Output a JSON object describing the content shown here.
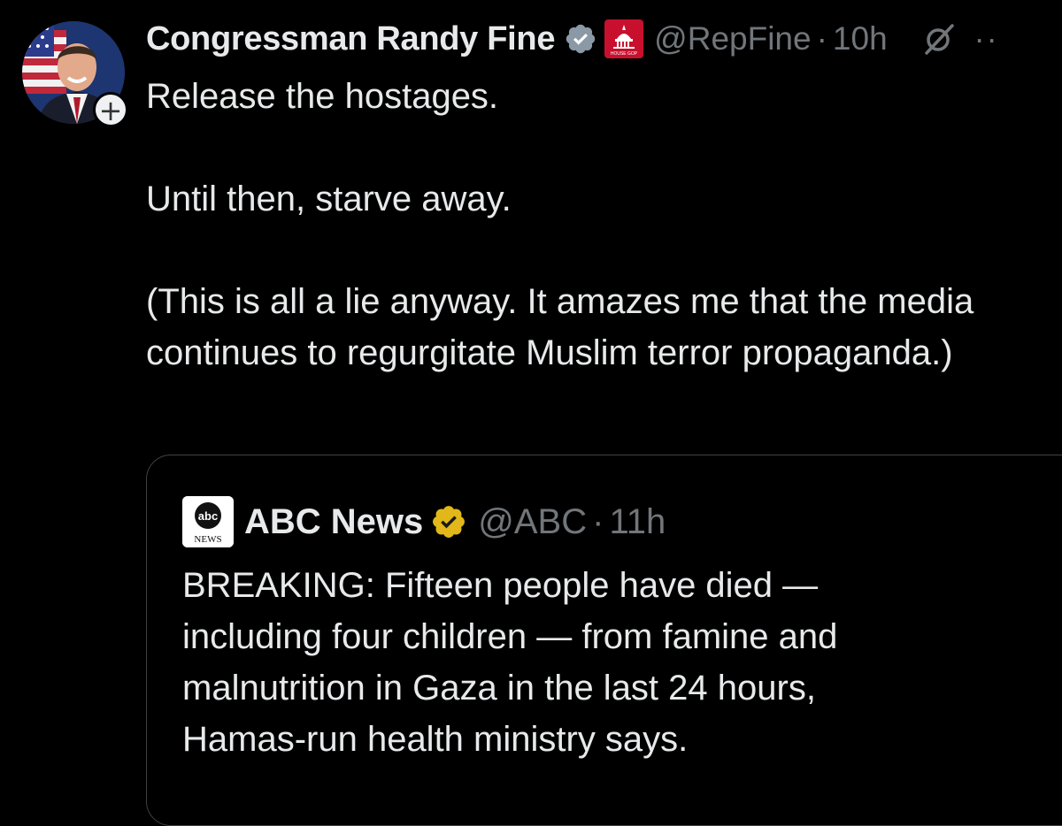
{
  "tweet": {
    "author_name": "Congressman Randy Fine",
    "handle": "@RepFine",
    "separator": "·",
    "time": "10h",
    "follow_symbol": "+",
    "more_symbol": "··",
    "text": "Release the hostages.\n\nUntil then, starve away.\n\n(This is all a lie anyway.  It amazes me that the media continues to regurgitate Muslim terror propaganda.)"
  },
  "quoted_tweet": {
    "author_name": "ABC News",
    "logo_text_top": "abc",
    "logo_text_bottom": "NEWS",
    "handle": "@ABC",
    "separator": "·",
    "time": "11h",
    "text": "BREAKING: Fifteen people have died —\nincluding four children — from famine and\nmalnutrition in Gaza in the last 24 hours,\nHamas-run health ministry says."
  },
  "icons": {
    "verified_color": "#8b98a5",
    "gold_verified_color": "#e2b719",
    "gov_badge_color": "#c8102e",
    "gov_badge_text": "HOUSE GOP"
  }
}
